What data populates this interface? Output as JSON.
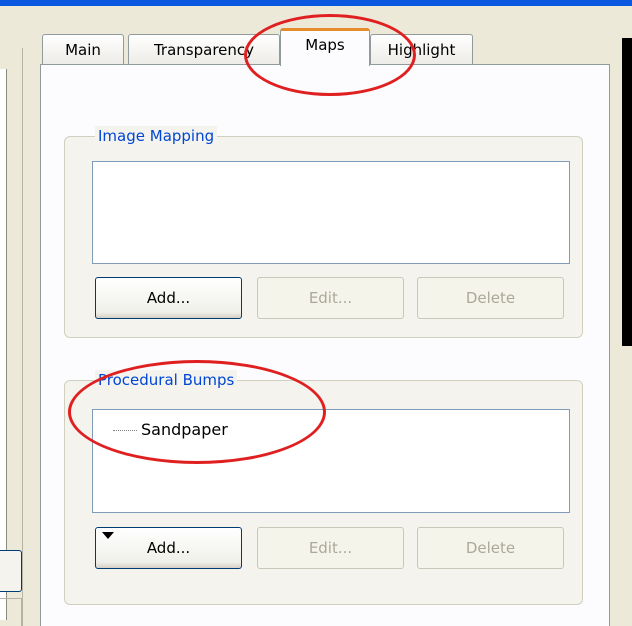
{
  "tabs": [
    {
      "label": "Main",
      "active": false
    },
    {
      "label": "Transparency",
      "active": false
    },
    {
      "label": "Maps",
      "active": true
    },
    {
      "label": "Highlight",
      "active": false
    }
  ],
  "image_mapping": {
    "title": "Image Mapping",
    "items": [],
    "add_label": "Add...",
    "edit_label": "Edit...",
    "delete_label": "Delete"
  },
  "procedural_bumps": {
    "title": "Procedural Bumps",
    "items": [
      "Sandpaper"
    ],
    "add_label": "Add...",
    "edit_label": "Edit...",
    "delete_label": "Delete"
  },
  "annotation_color": "#e02020",
  "colors": {
    "accent_blue": "#0a58e0",
    "group_title": "#0046d5",
    "active_tab_highlight": "#e68b2c"
  }
}
